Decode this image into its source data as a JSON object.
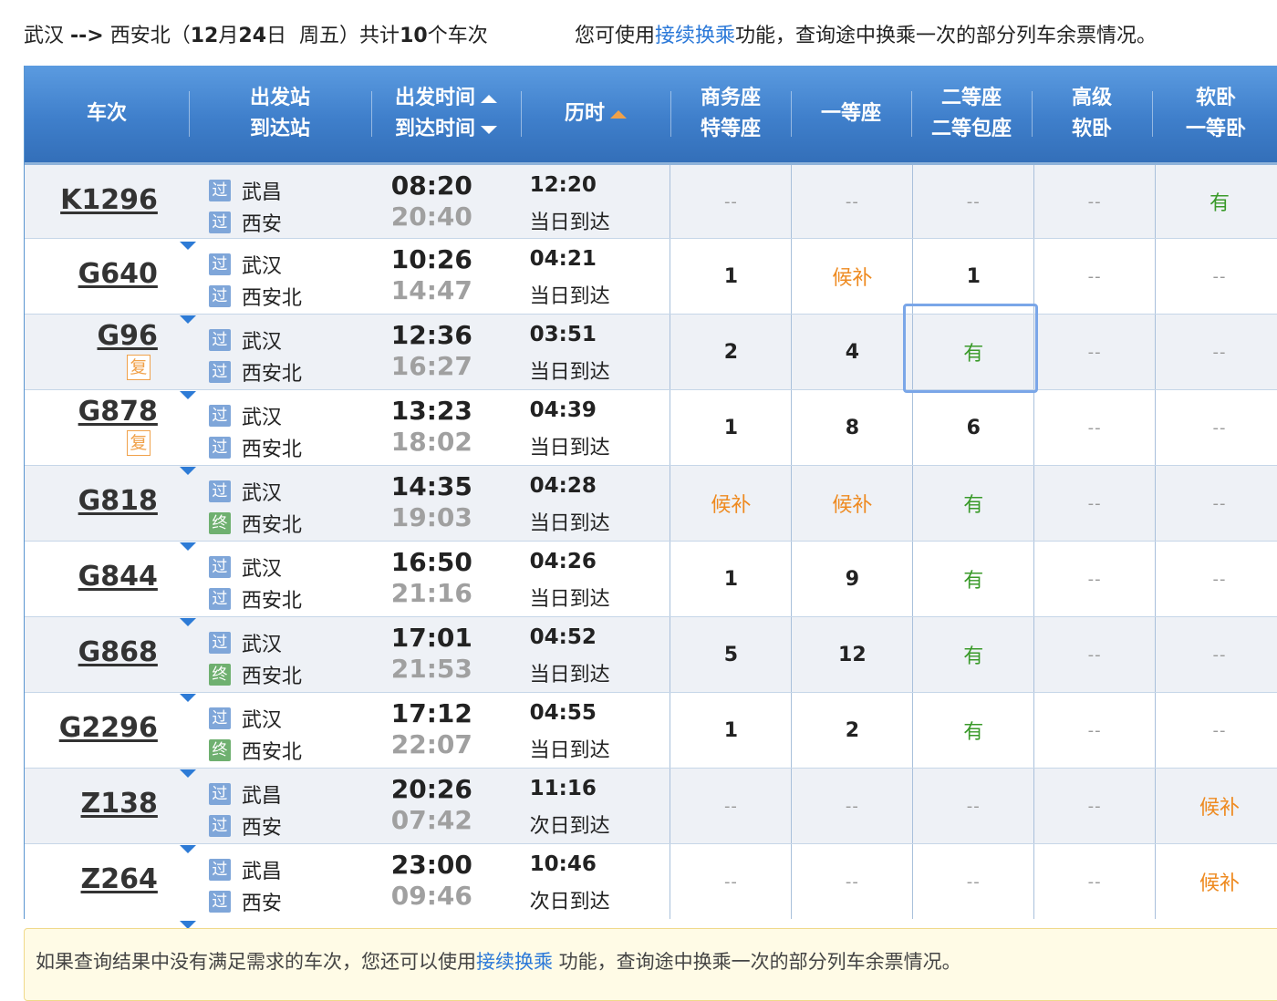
{
  "summary": {
    "from": "武汉",
    "arrow": "-->",
    "to": "西安北",
    "date_open": "（",
    "date_month": "12",
    "month_char": "月",
    "date_day": "24",
    "day_char": "日",
    "weekday": "周五",
    "date_close": "）共计",
    "count": "10",
    "count_unit": "个车次",
    "tip_prefix": "您可使用",
    "tip_link": "接续换乘",
    "tip_suffix": "功能，查询途中换乘一次的部分列车余票情况。"
  },
  "headers": {
    "train_no": "车次",
    "station_from": "出发站",
    "station_to": "到达站",
    "depart_time": "出发时间",
    "arrive_time": "到达时间",
    "duration": "历时",
    "business_1": "商务座",
    "business_2": "特等座",
    "first": "一等座",
    "second_1": "二等座",
    "second_2": "二等包座",
    "deluxe_1": "高级",
    "deluxe_2": "软卧",
    "soft_1": "软卧",
    "soft_2": "一等卧"
  },
  "badges": {
    "pass": "过",
    "end": "终",
    "fu": "复"
  },
  "trains": [
    {
      "no": "K1296",
      "fu": false,
      "from": "武昌",
      "to": "西安",
      "to_badge": "pass",
      "depart": "08:20",
      "arrive": "20:40",
      "duration": "12:20",
      "arrive_day": "当日到达",
      "business": "--",
      "first": "--",
      "second": "--",
      "deluxe": "--",
      "soft": "有"
    },
    {
      "no": "G640",
      "fu": false,
      "from": "武汉",
      "to": "西安北",
      "to_badge": "pass",
      "depart": "10:26",
      "arrive": "14:47",
      "duration": "04:21",
      "arrive_day": "当日到达",
      "business": "1",
      "first": "候补",
      "second": "1",
      "deluxe": "--",
      "soft": "--"
    },
    {
      "no": "G96",
      "fu": true,
      "from": "武汉",
      "to": "西安北",
      "to_badge": "pass",
      "depart": "12:36",
      "arrive": "16:27",
      "duration": "03:51",
      "arrive_day": "当日到达",
      "business": "2",
      "first": "4",
      "second": "有",
      "deluxe": "--",
      "soft": "--"
    },
    {
      "no": "G878",
      "fu": true,
      "from": "武汉",
      "to": "西安北",
      "to_badge": "pass",
      "depart": "13:23",
      "arrive": "18:02",
      "duration": "04:39",
      "arrive_day": "当日到达",
      "business": "1",
      "first": "8",
      "second": "6",
      "deluxe": "--",
      "soft": "--"
    },
    {
      "no": "G818",
      "fu": false,
      "from": "武汉",
      "to": "西安北",
      "to_badge": "end",
      "depart": "14:35",
      "arrive": "19:03",
      "duration": "04:28",
      "arrive_day": "当日到达",
      "business": "候补",
      "first": "候补",
      "second": "有",
      "deluxe": "--",
      "soft": "--"
    },
    {
      "no": "G844",
      "fu": false,
      "from": "武汉",
      "to": "西安北",
      "to_badge": "pass",
      "depart": "16:50",
      "arrive": "21:16",
      "duration": "04:26",
      "arrive_day": "当日到达",
      "business": "1",
      "first": "9",
      "second": "有",
      "deluxe": "--",
      "soft": "--"
    },
    {
      "no": "G868",
      "fu": false,
      "from": "武汉",
      "to": "西安北",
      "to_badge": "end",
      "depart": "17:01",
      "arrive": "21:53",
      "duration": "04:52",
      "arrive_day": "当日到达",
      "business": "5",
      "first": "12",
      "second": "有",
      "deluxe": "--",
      "soft": "--"
    },
    {
      "no": "G2296",
      "fu": false,
      "from": "武汉",
      "to": "西安北",
      "to_badge": "end",
      "depart": "17:12",
      "arrive": "22:07",
      "duration": "04:55",
      "arrive_day": "当日到达",
      "business": "1",
      "first": "2",
      "second": "有",
      "deluxe": "--",
      "soft": "--"
    },
    {
      "no": "Z138",
      "fu": false,
      "from": "武昌",
      "to": "西安",
      "to_badge": "pass",
      "depart": "20:26",
      "arrive": "07:42",
      "duration": "11:16",
      "arrive_day": "次日到达",
      "business": "--",
      "first": "--",
      "second": "--",
      "deluxe": "--",
      "soft": "候补"
    },
    {
      "no": "Z264",
      "fu": false,
      "from": "武昌",
      "to": "西安",
      "to_badge": "pass",
      "depart": "23:00",
      "arrive": "09:46",
      "duration": "10:46",
      "arrive_day": "次日到达",
      "business": "--",
      "first": "--",
      "second": "--",
      "deluxe": "--",
      "soft": "候补"
    }
  ],
  "note": {
    "prefix": "如果查询结果中没有满足需求的车次，您还可以使用",
    "link": "接续换乘",
    "suffix": " 功能，查询途中换乘一次的部分列车余票情况。"
  },
  "colors": {
    "header_blue": "#3f7fcb",
    "available_green": "#3a9a2a",
    "waitlist_orange": "#ee8a20",
    "link_blue": "#2a78d8"
  }
}
